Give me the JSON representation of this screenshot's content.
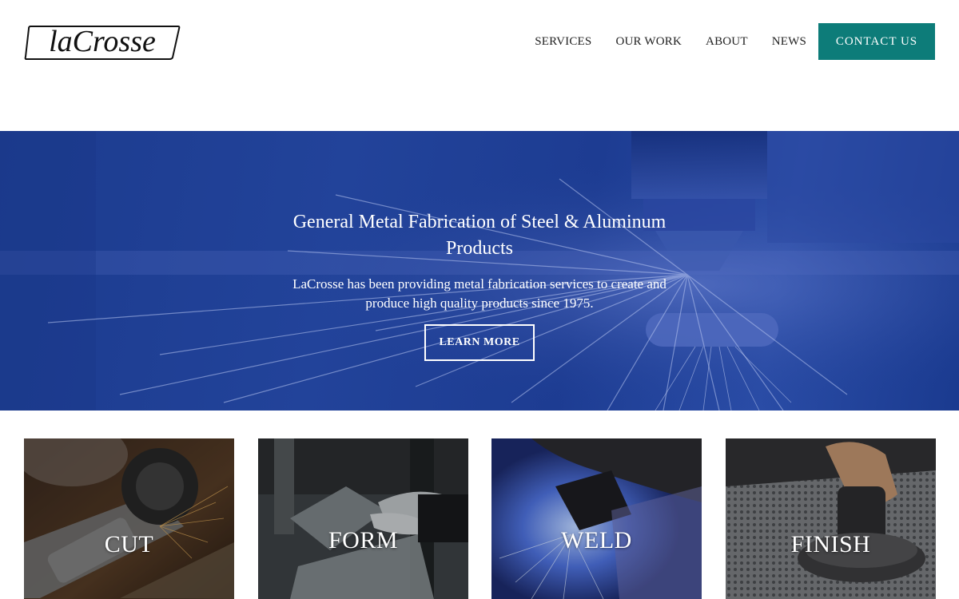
{
  "header": {
    "logo_text": "laCrosse",
    "nav": {
      "services": "SERVICES",
      "our_work": "OUR WORK",
      "about": "ABOUT",
      "news": "NEWS",
      "contact": "CONTACT US"
    },
    "accent_color": "#0d7c79"
  },
  "hero": {
    "title": "General Metal Fabrication of Steel & Aluminum Products",
    "subtitle": "LaCrosse has been providing metal fabrication services to create and produce high quality products since 1975.",
    "button": "LEARN MORE",
    "overlay_color": "#1f3f96"
  },
  "services": [
    {
      "label": "CUT"
    },
    {
      "label": "FORM"
    },
    {
      "label": "WELD"
    },
    {
      "label": "FINISH"
    }
  ]
}
